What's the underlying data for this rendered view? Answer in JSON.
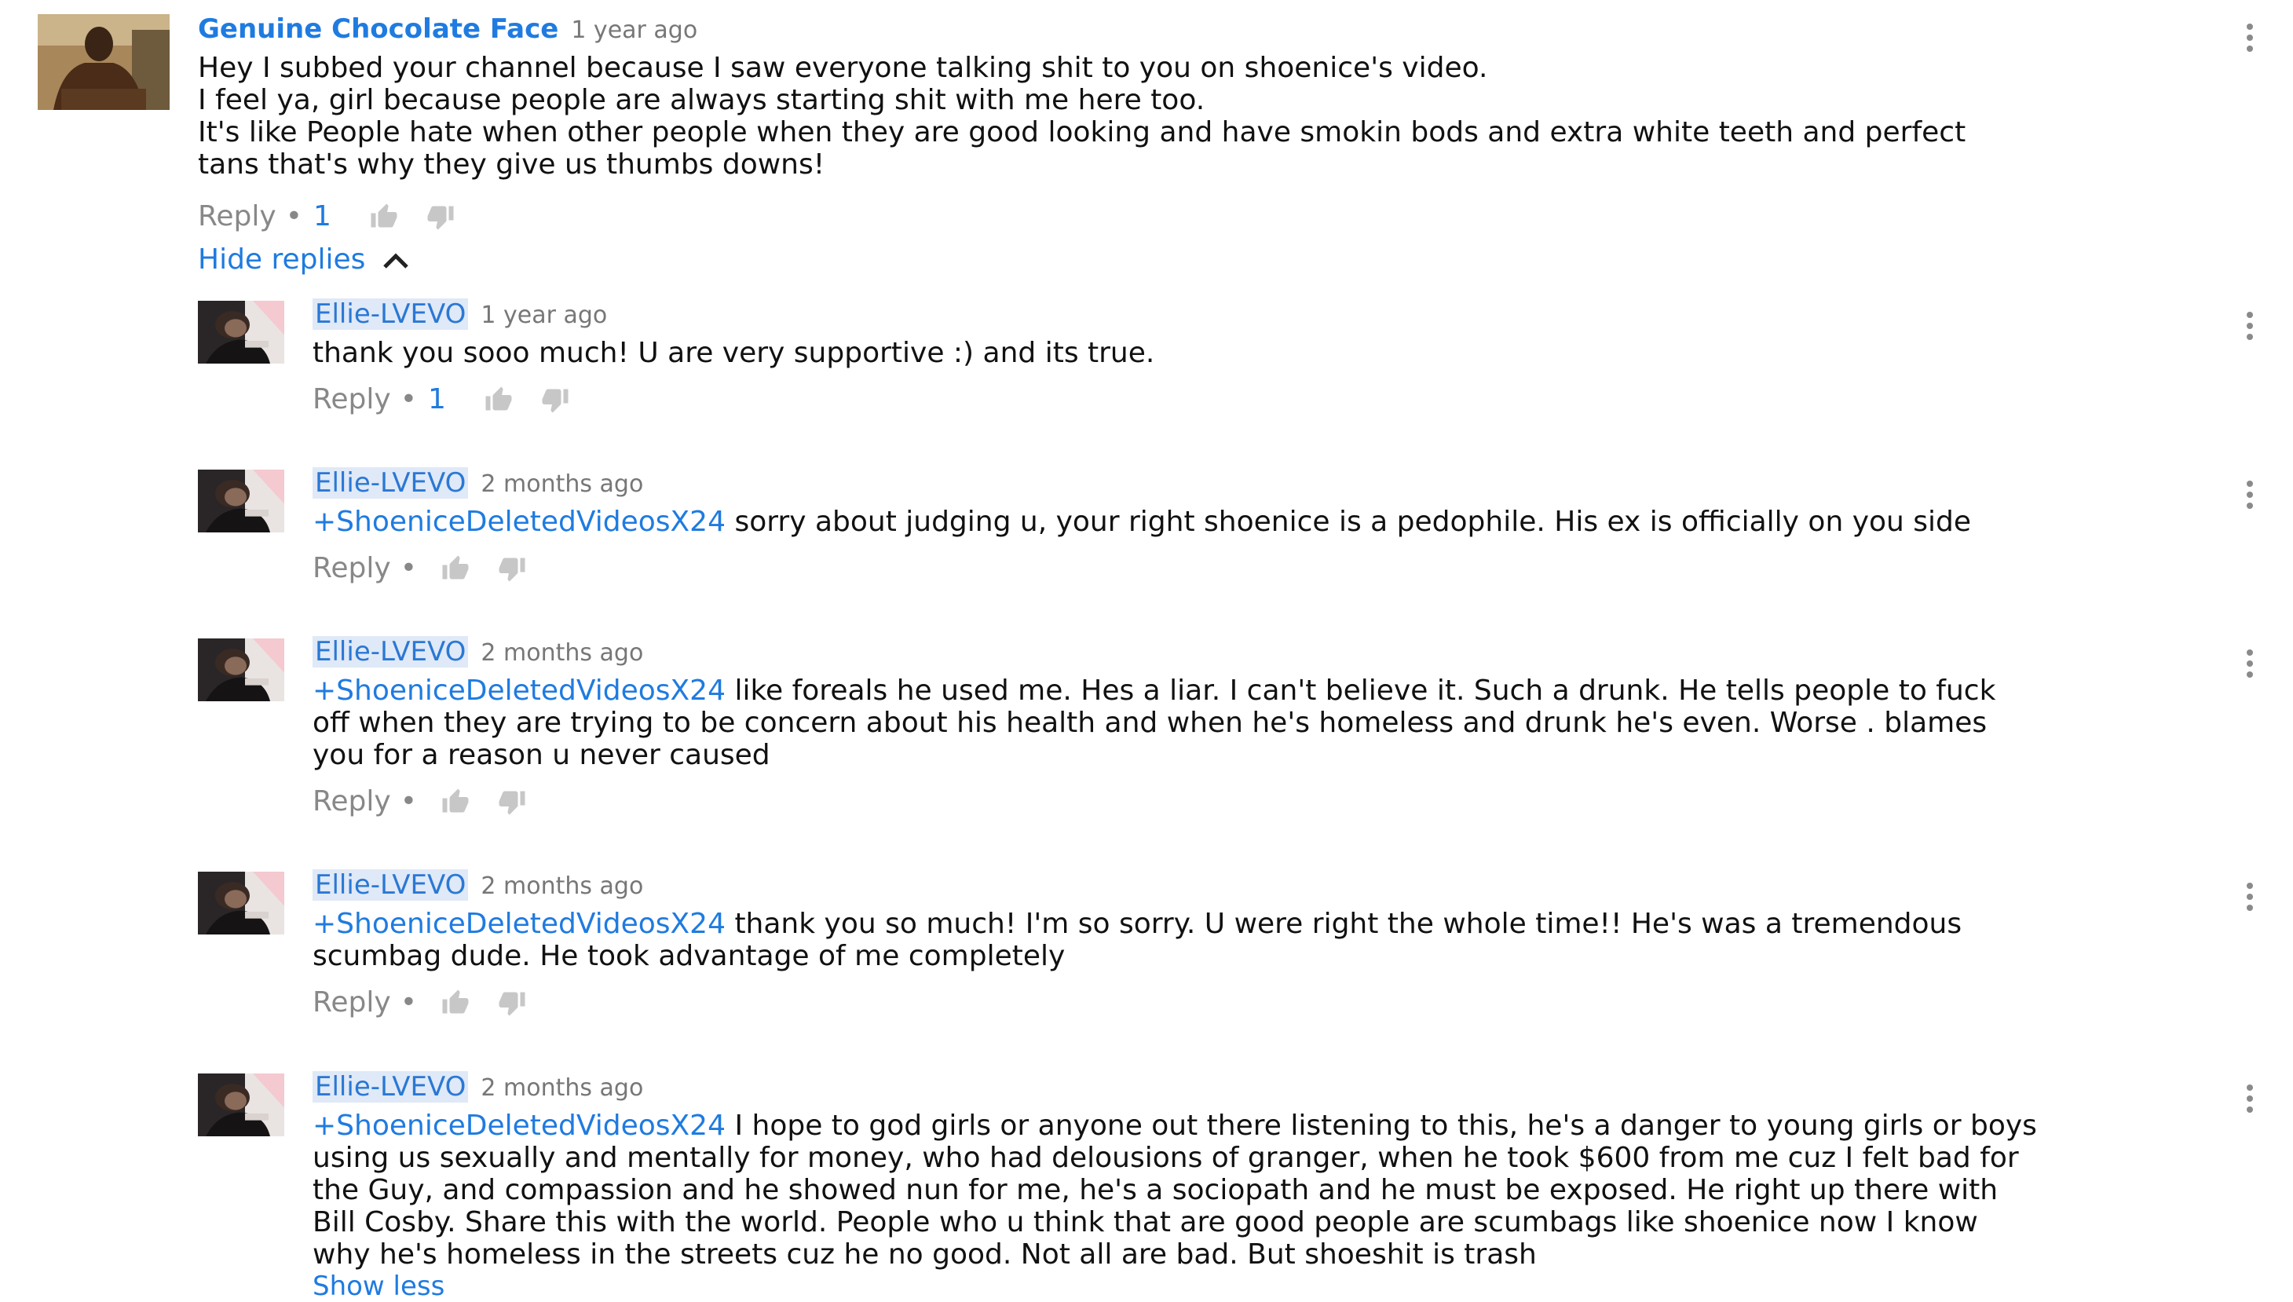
{
  "top_comment": {
    "author": "Genuine Chocolate Face",
    "time": "1 year ago",
    "lines": [
      "Hey I subbed your channel because I saw everyone talking shit to you on shoenice's video.",
      "I feel ya, girl because people are always starting shit with me here too.",
      "It's like People hate when other people when they are good looking and have smokin bods and extra white teeth and perfect",
      "tans that's why they give us thumbs downs!"
    ],
    "reply_label": "Reply",
    "like_count": "1"
  },
  "hide_replies_label": "Hide replies",
  "replies": [
    {
      "author": "Ellie-LVEVO",
      "time": "1 year ago",
      "mention": "",
      "lines": [
        "thank you sooo much! U are very supportive :) and its true."
      ],
      "reply_label": "Reply",
      "like_count": "1"
    },
    {
      "author": "Ellie-LVEVO",
      "time": "2 months ago",
      "mention": "+ShoeniceDeletedVideosX24",
      "lines": [
        " sorry about judging u, your right shoenice is a pedophile. His ex is officially on you side"
      ],
      "reply_label": "Reply",
      "like_count": ""
    },
    {
      "author": "Ellie-LVEVO",
      "time": "2 months ago",
      "mention": "+ShoeniceDeletedVideosX24",
      "lines": [
        " like foreals he used me. Hes a liar. I can't believe it. Such a drunk. He tells people to fuck",
        "off when they are trying to be concern about his health and when he's homeless and drunk he's even. Worse . blames",
        "you for a reason u never caused"
      ],
      "reply_label": "Reply",
      "like_count": ""
    },
    {
      "author": "Ellie-LVEVO",
      "time": "2 months ago",
      "mention": "+ShoeniceDeletedVideosX24",
      "lines": [
        " thank you so much! I'm so sorry. U were right the whole time!! He's was a tremendous",
        "scumbag dude. He took advantage of me completely"
      ],
      "reply_label": "Reply",
      "like_count": ""
    },
    {
      "author": "Ellie-LVEVO",
      "time": "2 months ago",
      "mention": "+ShoeniceDeletedVideosX24",
      "lines": [
        " I hope to god girls or anyone out there listening to this, he's a danger to young girls or boys",
        "using us sexually and mentally for money, who had delousions of granger, when he took $600 from me cuz I felt bad for",
        "the Guy, and compassion and he showed nun for me, he's a sociopath and he must be exposed. He right up there with",
        "Bill Cosby. Share this with the world. People who u think that are good people are scumbags like shoenice now I know",
        "why he's homeless in the streets cuz he no good. Not all are bad. But shoeshit is trash"
      ],
      "reply_label": "Reply",
      "like_count": "",
      "show_less_label": "Show less"
    }
  ],
  "colors": {
    "link_blue": "#1f7be0",
    "author_highlight": "#dfe9f7",
    "meta_gray": "#777777",
    "icon_gray": "#c7c7c7"
  },
  "icons": [
    "kebab-menu-icon",
    "thumbs-up-icon",
    "thumbs-down-icon",
    "chevron-up-icon"
  ]
}
